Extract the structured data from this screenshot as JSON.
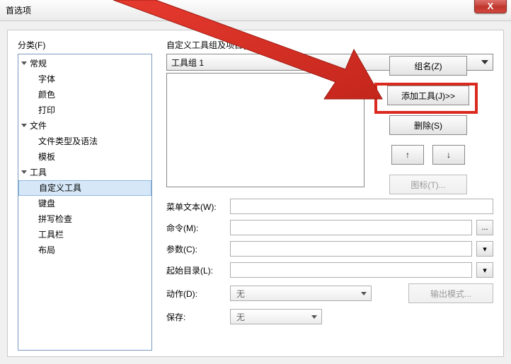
{
  "window": {
    "title": "首选项",
    "close_glyph": "X"
  },
  "left": {
    "label": "分类(F)",
    "tree": [
      {
        "level": 0,
        "label": "常规",
        "expandable": true
      },
      {
        "level": 1,
        "label": "字体"
      },
      {
        "level": 1,
        "label": "颜色"
      },
      {
        "level": 1,
        "label": "打印"
      },
      {
        "level": 0,
        "label": "文件",
        "expandable": true
      },
      {
        "level": 1,
        "label": "文件类型及语法"
      },
      {
        "level": 1,
        "label": "模板"
      },
      {
        "level": 0,
        "label": "工具",
        "expandable": true
      },
      {
        "level": 1,
        "label": "自定义工具",
        "selected": true
      },
      {
        "level": 1,
        "label": "键盘"
      },
      {
        "level": 1,
        "label": "拼写检查"
      },
      {
        "level": 1,
        "label": "工具栏"
      },
      {
        "level": 1,
        "label": "布局"
      }
    ]
  },
  "right": {
    "group_label": "自定义工具组及项目(G):",
    "group_value": "工具组 1",
    "buttons": {
      "rename": "组名(Z)",
      "add": "添加工具(J)>>",
      "delete": "删除(S)",
      "up": "↑",
      "down": "↓",
      "icon": "图标(T)...",
      "output_mode": "输出模式...",
      "browse_dots": "...",
      "dropdown_caret": "▾"
    },
    "fields": {
      "menu_text": "菜单文本(W):",
      "command": "命令(M):",
      "parameters": "参数(C):",
      "start_dir": "起始目录(L):",
      "action": "动作(D):",
      "save": "保存:"
    },
    "values": {
      "action": "无",
      "save": "无"
    }
  }
}
